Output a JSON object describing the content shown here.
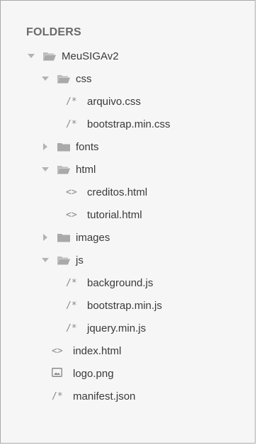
{
  "sidebar": {
    "header": "FOLDERS",
    "items": [
      {
        "label": "MeuSIGAv2",
        "kind": "folder",
        "state": "open",
        "icon": "folder-open-icon"
      },
      {
        "label": "css",
        "kind": "folder",
        "state": "open",
        "icon": "folder-open-icon"
      },
      {
        "label": "arquivo.css",
        "kind": "file",
        "glyph": "/*",
        "icon": "comment-icon"
      },
      {
        "label": "bootstrap.min.css",
        "kind": "file",
        "glyph": "/*",
        "icon": "comment-icon"
      },
      {
        "label": "fonts",
        "kind": "folder",
        "state": "closed",
        "icon": "folder-icon"
      },
      {
        "label": "html",
        "kind": "folder",
        "state": "open",
        "icon": "folder-open-icon"
      },
      {
        "label": "creditos.html",
        "kind": "file",
        "glyph": "<>",
        "icon": "code-icon"
      },
      {
        "label": "tutorial.html",
        "kind": "file",
        "glyph": "<>",
        "icon": "code-icon"
      },
      {
        "label": "images",
        "kind": "folder",
        "state": "closed",
        "icon": "folder-icon"
      },
      {
        "label": "js",
        "kind": "folder",
        "state": "open",
        "icon": "folder-open-icon"
      },
      {
        "label": "background.js",
        "kind": "file",
        "glyph": "/*",
        "icon": "comment-icon"
      },
      {
        "label": "bootstrap.min.js",
        "kind": "file",
        "glyph": "/*",
        "icon": "comment-icon"
      },
      {
        "label": "jquery.min.js",
        "kind": "file",
        "glyph": "/*",
        "icon": "comment-icon"
      },
      {
        "label": "index.html",
        "kind": "file",
        "glyph": "<>",
        "icon": "code-icon"
      },
      {
        "label": "logo.png",
        "kind": "file",
        "glyph": "",
        "icon": "image-icon"
      },
      {
        "label": "manifest.json",
        "kind": "file",
        "glyph": "/*",
        "icon": "comment-icon"
      }
    ]
  },
  "colors": {
    "background": "#f6f6f6",
    "border": "#a9a9a9",
    "text": "#3a3a3a",
    "header_text": "#6a6a6a",
    "folder": "#b9b9b9",
    "arrow": "#b3b3b3"
  }
}
